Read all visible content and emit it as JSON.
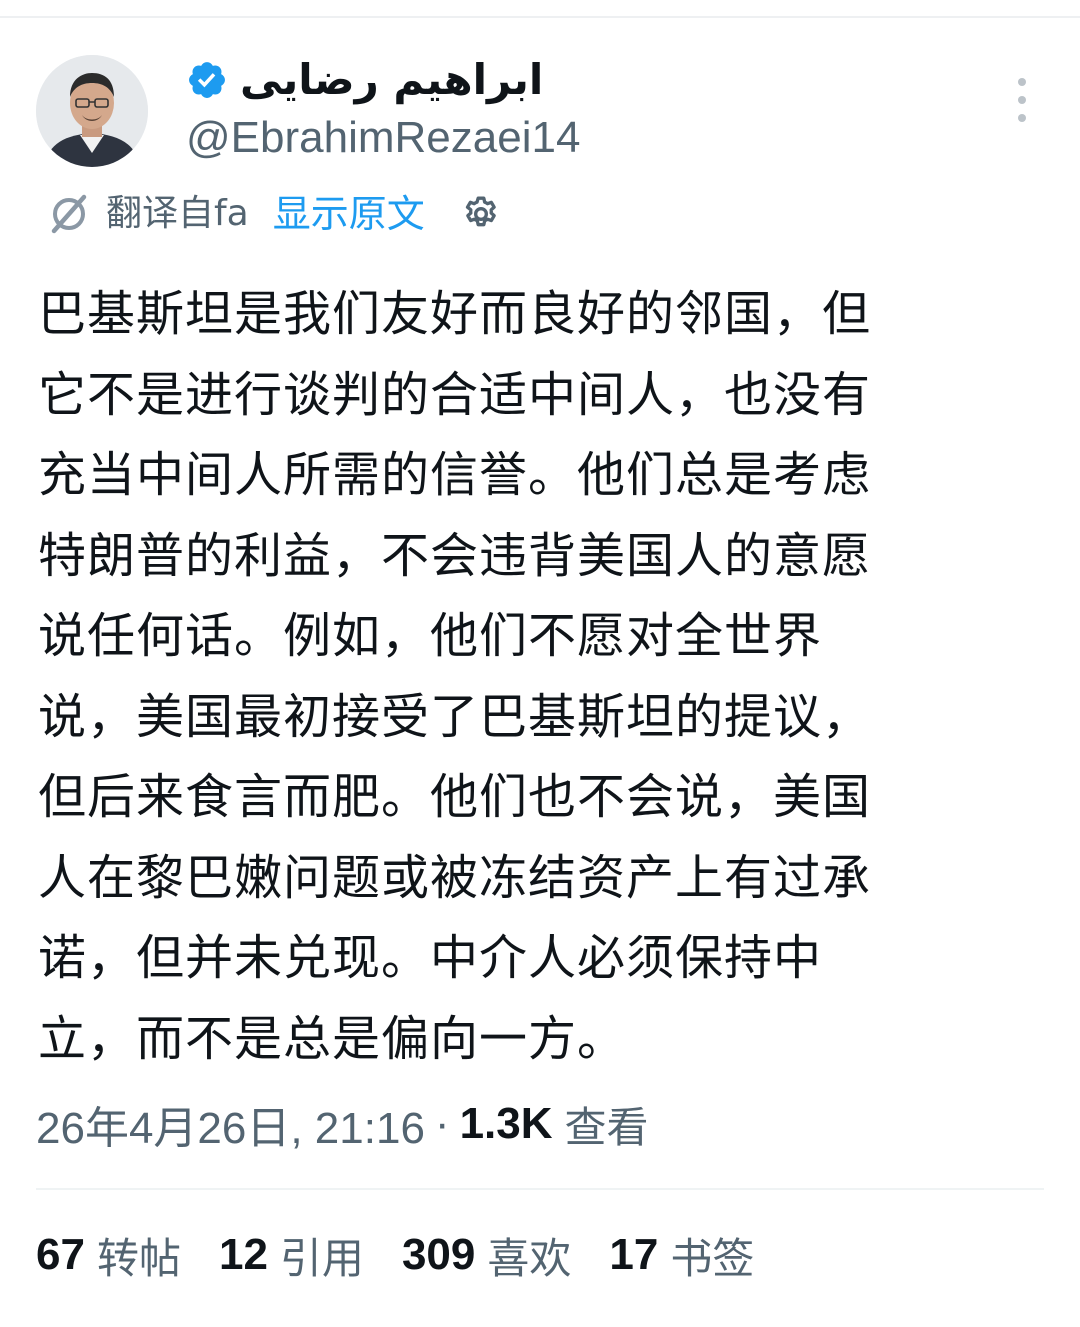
{
  "author": {
    "display_name": "ابراهیم رضایی",
    "handle": "@EbrahimRezaei14"
  },
  "translation": {
    "translated_from": "翻译自fa",
    "show_original": "显示原文"
  },
  "tweet": {
    "lines": [
      "巴基斯坦是我们友好而良好的邻国，但",
      "它不是进行谈判的合适中间人，也没有",
      "充当中间人所需的信誉。他们总是考虑",
      "特朗普的利益，不会违背美国人的意愿",
      "说任何话。例如，他们不愿对全世界",
      "说，美国最初接受了巴基斯坦的提议，",
      "但后来食言而肥。他们也不会说，美国",
      "人在黎巴嫩问题或被冻结资产上有过承",
      "诺，但并未兑现。中介人必须保持中",
      "立，而不是总是偏向一方。"
    ]
  },
  "meta": {
    "date": "26年4月26日, 21:16",
    "separator": "·",
    "views_count": "1.3K",
    "views_label": "查看"
  },
  "stats": [
    {
      "count": "67",
      "label": "转帖"
    },
    {
      "count": "12",
      "label": "引用"
    },
    {
      "count": "309",
      "label": "喜欢"
    },
    {
      "count": "17",
      "label": "书签"
    }
  ],
  "icons": {
    "verified": "verified-badge-icon",
    "translate": "translate-icon",
    "settings": "gear-icon",
    "more": "more-options-icon"
  },
  "colors": {
    "accent": "#1d9bf0",
    "text_primary": "#0f1419",
    "text_secondary": "#536471"
  }
}
